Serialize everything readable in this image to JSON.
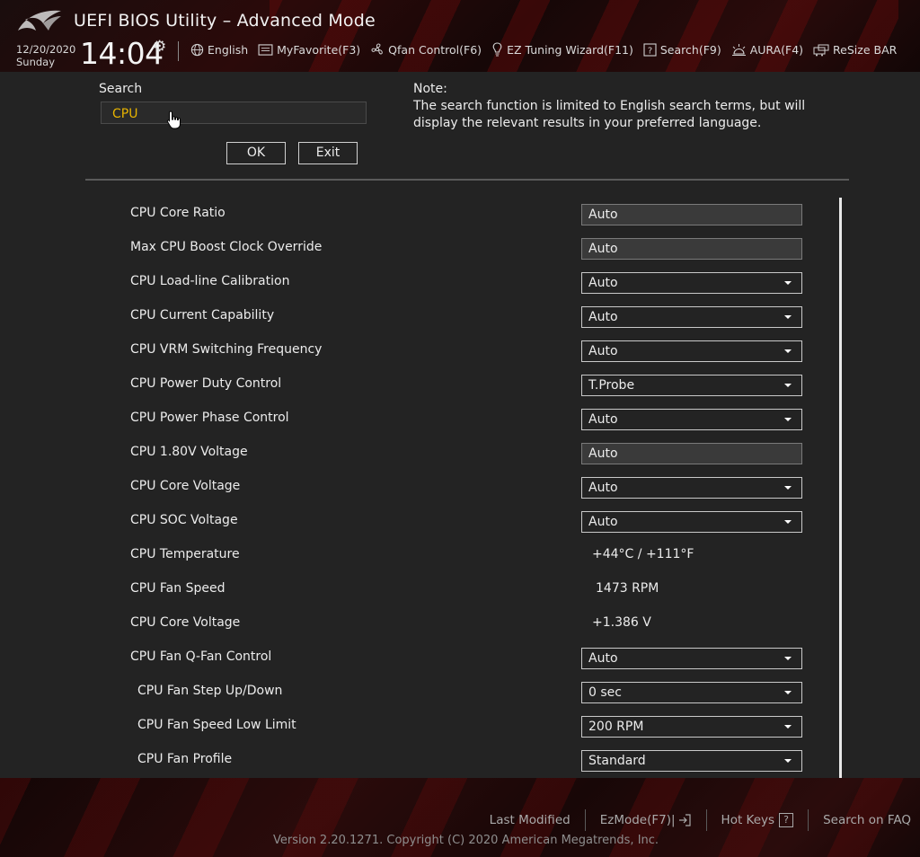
{
  "header": {
    "title": "UEFI BIOS Utility – Advanced Mode",
    "date": "12/20/2020",
    "day": "Sunday",
    "time": "14:04",
    "nav": [
      {
        "label": "English",
        "icon": "globe-icon"
      },
      {
        "label": "MyFavorite(F3)",
        "icon": "favorite-icon"
      },
      {
        "label": "Qfan Control(F6)",
        "icon": "fan-icon"
      },
      {
        "label": "EZ Tuning Wizard(F11)",
        "icon": "lightbulb-icon"
      },
      {
        "label": "Search(F9)",
        "icon": "search-help-icon"
      },
      {
        "label": "AURA(F4)",
        "icon": "aura-icon"
      },
      {
        "label": "ReSize BAR",
        "icon": "resize-bar-icon"
      }
    ]
  },
  "search": {
    "label": "Search",
    "value": "CPU",
    "ok_label": "OK",
    "exit_label": "Exit",
    "note_title": "Note:",
    "note_body": "The search function is limited to English search terms, but will display the relevant results in your preferred language."
  },
  "results": [
    {
      "label": "CPU Core Ratio",
      "kind": "fixed",
      "value": "Auto"
    },
    {
      "label": "Max CPU Boost Clock Override",
      "kind": "fixed",
      "value": "Auto"
    },
    {
      "label": "CPU Load-line Calibration",
      "kind": "dropdown",
      "value": "Auto"
    },
    {
      "label": "CPU Current Capability",
      "kind": "dropdown",
      "value": "Auto"
    },
    {
      "label": "CPU VRM Switching Frequency",
      "kind": "dropdown",
      "value": "Auto"
    },
    {
      "label": "CPU Power Duty Control",
      "kind": "dropdown",
      "value": "T.Probe"
    },
    {
      "label": "CPU Power Phase Control",
      "kind": "dropdown",
      "value": "Auto"
    },
    {
      "label": "CPU 1.80V Voltage",
      "kind": "fixed",
      "value": "Auto"
    },
    {
      "label": "CPU Core Voltage",
      "kind": "dropdown",
      "value": "Auto"
    },
    {
      "label": "CPU SOC Voltage",
      "kind": "dropdown",
      "value": "Auto"
    },
    {
      "label": "CPU Temperature",
      "kind": "readout",
      "value": "+44°C / +111°F"
    },
    {
      "label": "CPU Fan Speed",
      "kind": "readout",
      "value": "1473 RPM"
    },
    {
      "label": "CPU Core Voltage",
      "kind": "readout",
      "value": "+1.386 V"
    },
    {
      "label": "CPU Fan Q-Fan Control",
      "kind": "dropdown",
      "value": "Auto"
    },
    {
      "label": "CPU Fan Step Up/Down",
      "kind": "dropdown",
      "value": "0 sec",
      "sub": true
    },
    {
      "label": "CPU Fan Speed Low Limit",
      "kind": "dropdown",
      "value": "200 RPM",
      "sub": true
    },
    {
      "label": "CPU Fan Profile",
      "kind": "dropdown",
      "value": "Standard",
      "sub": true
    }
  ],
  "footer": {
    "last_modified": "Last Modified",
    "ezmode": "EzMode(F7)|",
    "hot_keys": "Hot Keys",
    "hot_keys_key": "?",
    "faq": "Search on FAQ",
    "version": "Version 2.20.1271. Copyright (C) 2020 American Megatrends, Inc."
  },
  "colors": {
    "accent_search_text": "#e8b400",
    "background": "#232323",
    "header_red": "#2b0a0a"
  }
}
